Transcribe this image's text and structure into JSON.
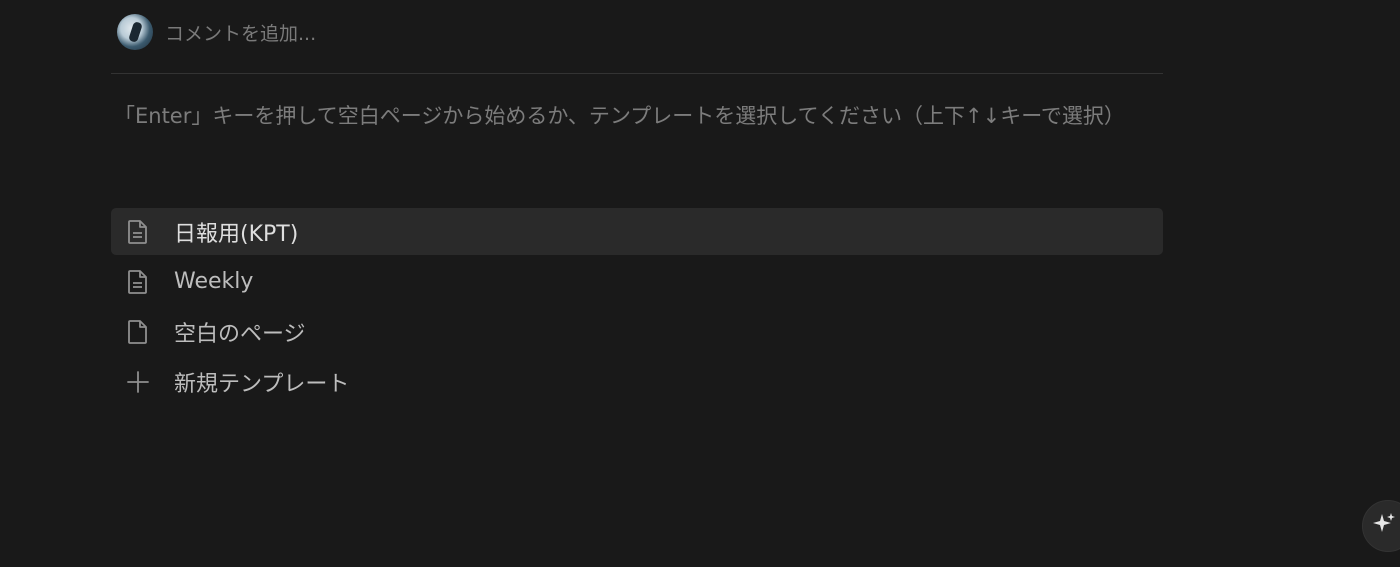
{
  "comment": {
    "placeholder": "コメントを追加..."
  },
  "hint": {
    "text": "「Enter」キーを押して空白ページから始めるか、テンプレートを選択してください（上下↑↓キーで選択）"
  },
  "templates": [
    {
      "label": "日報用(KPT)",
      "icon": "document-text-icon",
      "active": true
    },
    {
      "label": "Weekly",
      "icon": "document-text-icon",
      "active": false
    },
    {
      "label": "空白のページ",
      "icon": "document-blank-icon",
      "active": false
    },
    {
      "label": "新規テンプレート",
      "icon": "plus-icon",
      "active": false
    }
  ],
  "colors": {
    "background": "#191919",
    "active_row": "#2a2a2a",
    "muted_text": "#7c7c7c"
  },
  "ai_button": {
    "icon": "sparkle-icon"
  }
}
